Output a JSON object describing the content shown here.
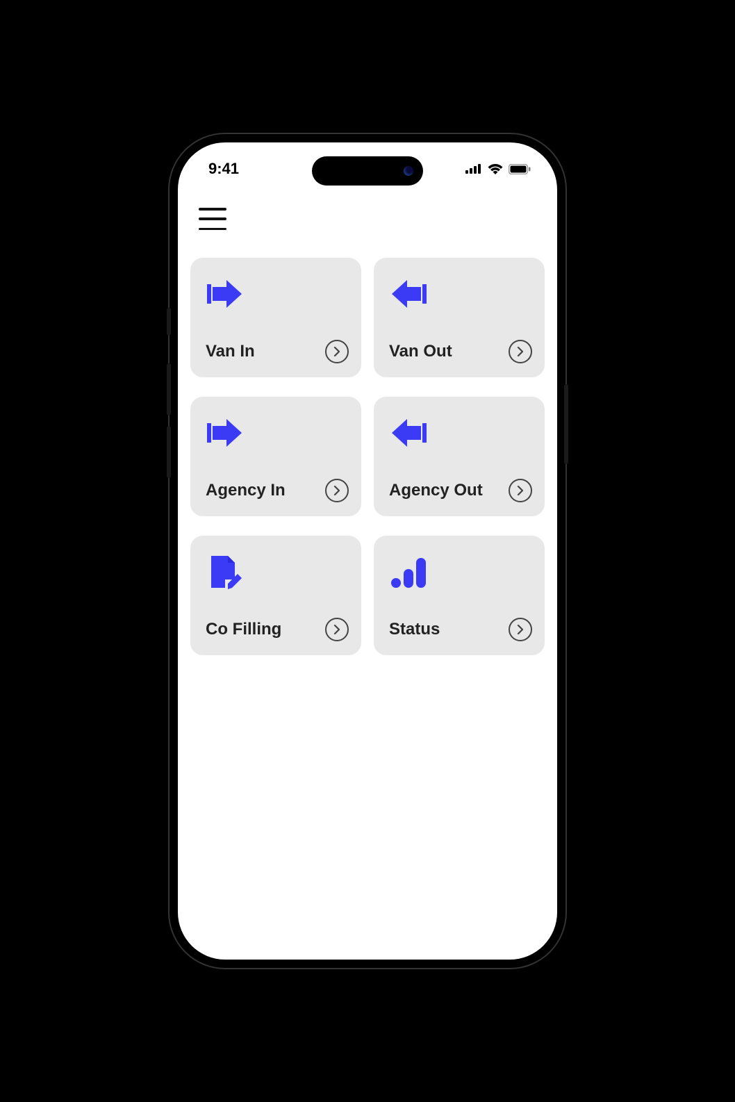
{
  "status": {
    "time": "9:41"
  },
  "colors": {
    "accent": "#3b3bf5",
    "cardBg": "#e8e8e8"
  },
  "cards": [
    {
      "id": "van-in",
      "label": "Van In",
      "icon": "arrow-in"
    },
    {
      "id": "van-out",
      "label": "Van Out",
      "icon": "arrow-out"
    },
    {
      "id": "agency-in",
      "label": "Agency In",
      "icon": "arrow-in"
    },
    {
      "id": "agency-out",
      "label": "Agency Out",
      "icon": "arrow-out"
    },
    {
      "id": "co-filling",
      "label": "Co Filling",
      "icon": "file-edit"
    },
    {
      "id": "status",
      "label": "Status",
      "icon": "chart"
    }
  ]
}
